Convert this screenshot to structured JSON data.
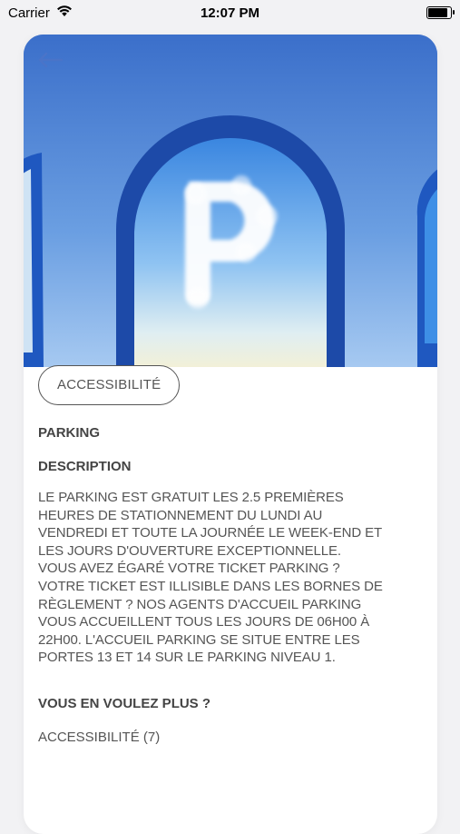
{
  "status_bar": {
    "carrier": "Carrier",
    "time": "12:07 PM",
    "icons": [
      "wifi-icon",
      "battery-icon"
    ]
  },
  "header": {
    "back_icon": "arrow-left-icon",
    "hero_image": "parking-cloud-p-arch"
  },
  "tag": {
    "label": "ACCESSIBILITÉ"
  },
  "place": {
    "title": "PARKING"
  },
  "description": {
    "heading": "DESCRIPTION",
    "text": "LE PARKING EST GRATUIT LES 2.5 PREMIÈRES HEURES DE STATIONNEMENT DU LUNDI AU VENDREDI ET TOUTE LA JOURNÉE LE WEEK-END ET LES JOURS D'OUVERTURE EXCEPTIONNELLE. VOUS AVEZ ÉGARÉ VOTRE TICKET PARKING ? VOTRE TICKET EST ILLISIBLE DANS LES BORNES DE RÈGLEMENT ? NOS AGENTS D'ACCUEIL PARKING VOUS ACCUEILLENT TOUS LES JOURS DE 06H00 À 22H00. L'ACCUEIL PARKING SE SITUE ENTRE LES PORTES 13 ET 14 SUR LE PARKING NIVEAU 1."
  },
  "more": {
    "heading": "VOUS EN VOULEZ PLUS ?",
    "link": "ACCESSIBILITÉ (7)"
  },
  "colors": {
    "sky_blue": "#5790dc",
    "arch_blue": "#1f4fb0",
    "text_gray": "#555555"
  }
}
